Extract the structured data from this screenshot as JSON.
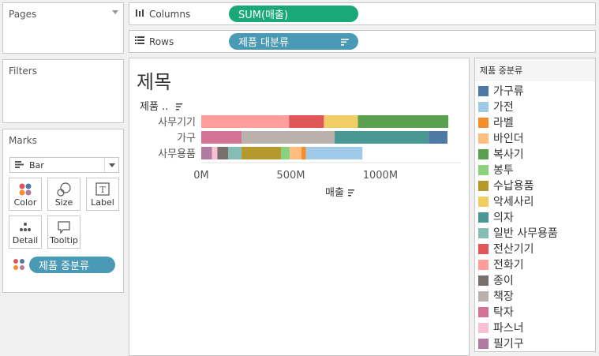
{
  "pages": {
    "title": "Pages"
  },
  "filters": {
    "title": "Filters"
  },
  "marks": {
    "title": "Marks",
    "mark_type": "Bar",
    "cards": [
      "Color",
      "Size",
      "Label",
      "Detail",
      "Tooltip"
    ],
    "color_pill": "제품 중분류"
  },
  "shelves": {
    "columns_label": "Columns",
    "columns_pill": "SUM(매출)",
    "rows_label": "Rows",
    "rows_pill": "제품 대분류"
  },
  "colors": {
    "columns_pill": "#1aa879",
    "rows_pill": "#4a9ab5",
    "color_pill": "#4a9ab5"
  },
  "legend": {
    "title": "제품 중분류",
    "items": [
      {
        "name": "가구류",
        "color": "#4e79a7"
      },
      {
        "name": "가전",
        "color": "#a0cbe8"
      },
      {
        "name": "라벨",
        "color": "#f28e2b"
      },
      {
        "name": "바인더",
        "color": "#ffbe7d"
      },
      {
        "name": "복사기",
        "color": "#59a14f"
      },
      {
        "name": "봉투",
        "color": "#8cd17d"
      },
      {
        "name": "수납용품",
        "color": "#b6992d"
      },
      {
        "name": "악세사리",
        "color": "#f1ce63"
      },
      {
        "name": "의자",
        "color": "#499894"
      },
      {
        "name": "일반 사무용품",
        "color": "#86bcb6"
      },
      {
        "name": "전산기기",
        "color": "#e15759"
      },
      {
        "name": "전화기",
        "color": "#ff9d9a"
      },
      {
        "name": "종이",
        "color": "#79706e"
      },
      {
        "name": "책장",
        "color": "#bab0ac"
      },
      {
        "name": "탁자",
        "color": "#d37295"
      },
      {
        "name": "파스너",
        "color": "#fabfd2"
      },
      {
        "name": "필기구",
        "color": "#b07aa1"
      }
    ]
  },
  "chart_data": {
    "type": "bar",
    "title": "제목",
    "row_header": "제품 ..",
    "xlabel": "매출",
    "x_ticks": [
      "0M",
      "500M",
      "1000M"
    ],
    "xlim": [
      0,
      1450
    ],
    "categories": [
      "사무기기",
      "가구",
      "사무용품"
    ],
    "stacks": [
      [
        {
          "name": "전화기",
          "value": 490
        },
        {
          "name": "전산기기",
          "value": 195
        },
        {
          "name": "악세사리",
          "value": 190
        },
        {
          "name": "복사기",
          "value": 505
        }
      ],
      [
        {
          "name": "탁자",
          "value": 225
        },
        {
          "name": "책장",
          "value": 520
        },
        {
          "name": "의자",
          "value": 525
        },
        {
          "name": "가구류",
          "value": 105
        }
      ],
      [
        {
          "name": "필기구",
          "value": 60
        },
        {
          "name": "파스너",
          "value": 30
        },
        {
          "name": "종이",
          "value": 60
        },
        {
          "name": "일반 사무용품",
          "value": 75
        },
        {
          "name": "수납용품",
          "value": 220
        },
        {
          "name": "봉투",
          "value": 50
        },
        {
          "name": "바인더",
          "value": 65
        },
        {
          "name": "라벨",
          "value": 25
        },
        {
          "name": "가전",
          "value": 315
        }
      ]
    ]
  }
}
